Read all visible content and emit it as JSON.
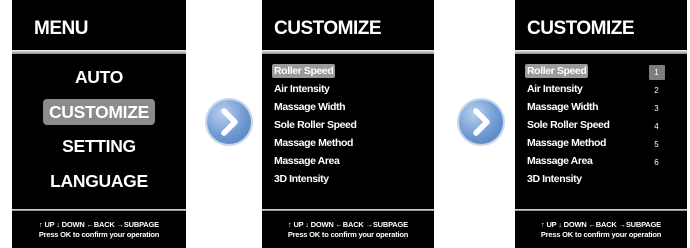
{
  "screens": {
    "menu": {
      "title": "MENU",
      "items": [
        "AUTO",
        "CUSTOMIZE",
        "SETTING",
        "LANGUAGE"
      ],
      "selected_index": 1
    },
    "customize_a": {
      "title": "CUSTOMIZE",
      "options": [
        "Roller Speed",
        "Air Intensity",
        "Massage Width",
        "Sole Roller Speed",
        "Massage Method",
        "Massage Area",
        "3D Intensity"
      ],
      "selected_index": 0
    },
    "customize_b": {
      "title": "CUSTOMIZE",
      "options": [
        "Roller Speed",
        "Air Intensity",
        "Massage Width",
        "Sole Roller Speed",
        "Massage Method",
        "Massage Area",
        "3D Intensity"
      ],
      "selected_index": 0,
      "levels": [
        "1",
        "2",
        "3",
        "4",
        "5",
        "6"
      ],
      "selected_level_index": 0
    }
  },
  "footer": {
    "line1": "↑ UP ↓ DOWN ←BACK →SUBPAGE",
    "line2": "Press OK to confirm your operation"
  },
  "icons": {
    "next": "chevron-right-icon"
  },
  "colors": {
    "screen_bg": "#000000",
    "highlight": "#8b8b8b",
    "arrow_button": "#6e99d2"
  }
}
